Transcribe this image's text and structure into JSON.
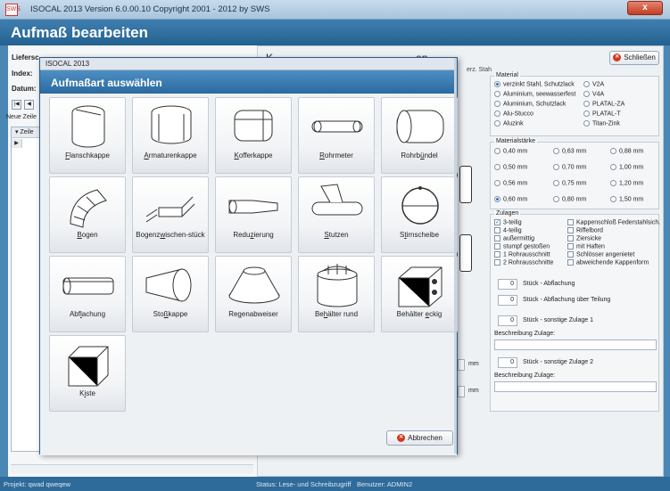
{
  "window": {
    "app_icon_text": "SWS",
    "title": "ISOCAL 2013   Version 6.0.00.10     Copyright 2001 - 2012 by SWS",
    "close_label": "x"
  },
  "header": {
    "title": "Aufmaß bearbeiten"
  },
  "left": {
    "supplier_label": "Liefersc",
    "index_label": "Index:",
    "date_label": "Datum:",
    "new_row_label": "Neue Zeile",
    "grid_column": "Zeile"
  },
  "right": {
    "title": "K...",
    "title_suffix": "en",
    "sub": "erz. Stah",
    "close_button": "Schließen",
    "material": {
      "title": "Material",
      "options": [
        {
          "label": "verzinkt Stahl,  Schutzlack",
          "checked": true
        },
        {
          "label": "V2A",
          "checked": false
        },
        {
          "label": "Aluminium, seewasserfest",
          "checked": false
        },
        {
          "label": "V4A",
          "checked": false
        },
        {
          "label": "Aluminium, Schutzlack",
          "checked": false
        },
        {
          "label": "PLATAL-ZA",
          "checked": false
        },
        {
          "label": "Alu-Stucco",
          "checked": false
        },
        {
          "label": "PLATAL-T",
          "checked": false
        },
        {
          "label": "Aluzink",
          "checked": false
        },
        {
          "label": "Titan-Zink",
          "checked": false
        }
      ]
    },
    "thickness": {
      "title": "Materialstärke",
      "options": [
        {
          "label": "0,40 mm",
          "checked": false
        },
        {
          "label": "0,63 mm",
          "checked": false
        },
        {
          "label": "0,88 mm",
          "checked": false
        },
        {
          "label": "0,50 mm",
          "checked": false
        },
        {
          "label": "0,70 mm",
          "checked": false
        },
        {
          "label": "1,00 mm",
          "checked": false
        },
        {
          "label": "0,56 mm",
          "checked": false
        },
        {
          "label": "0,75 mm",
          "checked": false
        },
        {
          "label": "1,20 mm",
          "checked": false
        },
        {
          "label": "0,60 mm",
          "checked": true
        },
        {
          "label": "0,80 mm",
          "checked": false
        },
        {
          "label": "1,50 mm",
          "checked": false
        }
      ]
    },
    "extras": {
      "title": "Zulagen",
      "options": [
        {
          "label": "3-teilig",
          "checked": true
        },
        {
          "label": "Kappenschloß Federstahlsich.",
          "checked": false
        },
        {
          "label": "4-teilig",
          "checked": false
        },
        {
          "label": "Riffelbord",
          "checked": false
        },
        {
          "label": "außermittig",
          "checked": false
        },
        {
          "label": "Ziersicke",
          "checked": false
        },
        {
          "label": "stumpf gestoßen",
          "checked": false
        },
        {
          "label": "mit Haften",
          "checked": false
        },
        {
          "label": "1  Rohrausschnitt",
          "checked": false
        },
        {
          "label": "Schlösser angenietet",
          "checked": false
        },
        {
          "label": "2  Rohrausschnitte",
          "checked": false
        },
        {
          "label": "abweichende Kappenform",
          "checked": false
        }
      ],
      "counters": [
        {
          "value": "0",
          "label": "Stück - Abflachung"
        },
        {
          "value": "0",
          "label": "Stück - Abflachung über Teilung"
        },
        {
          "value": "0",
          "label": "Stück - sonstige Zulage 1"
        }
      ],
      "desc1_label": "Beschreibung Zulage:",
      "counter4": {
        "value": "0",
        "label": "Stück - sonstige Zulage 2"
      },
      "desc2_label": "Beschreibung Zulage:"
    },
    "unit_mm": "mm"
  },
  "dialog": {
    "window_title": "ISOCAL 2013",
    "header": "Aufmaßart auswählen",
    "tiles": [
      {
        "pre": "",
        "u": "F",
        "post": "lanschkappe",
        "icon": "flange-cap-icon"
      },
      {
        "pre": "",
        "u": "A",
        "post": "rmaturenkappe",
        "icon": "valve-cap-icon"
      },
      {
        "pre": "",
        "u": "K",
        "post": "offerkappe",
        "icon": "box-cap-icon"
      },
      {
        "pre": "",
        "u": "R",
        "post": "ohrmeter",
        "icon": "pipe-meter-icon"
      },
      {
        "pre": "Rohrb",
        "u": "ü",
        "post": "ndel",
        "icon": "pipe-bundle-icon"
      },
      {
        "pre": "",
        "u": "B",
        "post": "ogen",
        "icon": "elbow-icon"
      },
      {
        "pre": "Bogenz",
        "u": "w",
        "post": "ischen-stück",
        "icon": "intermediate-bend-icon"
      },
      {
        "pre": "Redu",
        "u": "z",
        "post": "ierung",
        "icon": "reducer-icon"
      },
      {
        "pre": "",
        "u": "S",
        "post": "tutzen",
        "icon": "branch-icon"
      },
      {
        "pre": "S",
        "u": "t",
        "post": "irnscheibe",
        "icon": "end-disc-icon"
      },
      {
        "pre": "Abf",
        "u": "l",
        "post": "achung",
        "icon": "flattening-icon"
      },
      {
        "pre": "Sto",
        "u": "ß",
        "post": "kappe",
        "icon": "butt-cap-icon"
      },
      {
        "pre": "Re",
        "u": "g",
        "post": "enabweiser",
        "icon": "rain-deflector-icon"
      },
      {
        "pre": "Be",
        "u": "h",
        "post": "älter rund",
        "icon": "round-tank-icon"
      },
      {
        "pre": "Behälter ",
        "u": "e",
        "post": "ckig",
        "icon": "square-tank-icon"
      },
      {
        "pre": "K",
        "u": "i",
        "post": "ste",
        "icon": "box-icon"
      }
    ],
    "cancel_label": "Abbrechen"
  },
  "status": {
    "project": "Projekt: qwad  qweqew",
    "access": "Status: Lese- und Schreibzugriff",
    "user": "Benutzer: ADMIN2"
  }
}
